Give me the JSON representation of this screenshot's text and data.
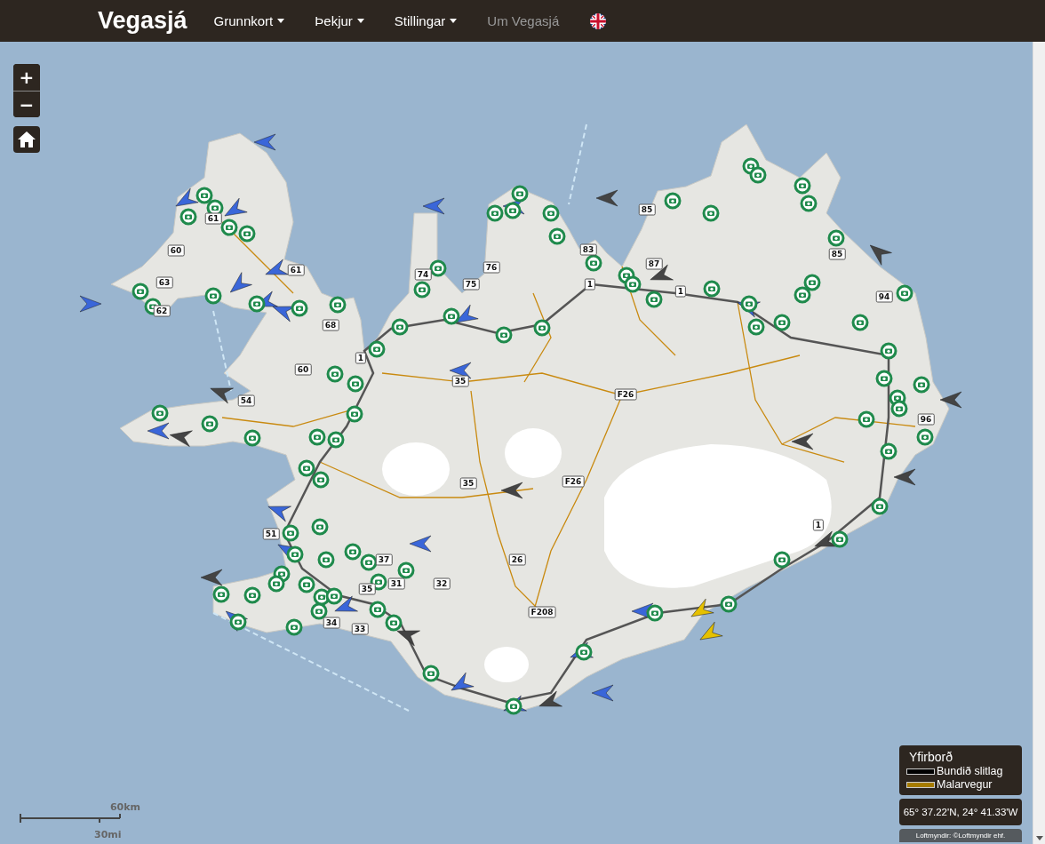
{
  "navbar": {
    "brand": "Vegasjá",
    "menus": [
      {
        "label": "Grunnkort",
        "dropdown": true
      },
      {
        "label": "Þekjur",
        "dropdown": true
      },
      {
        "label": "Stillingar",
        "dropdown": true
      },
      {
        "label": "Um Vegasjá",
        "dropdown": false
      }
    ]
  },
  "zoom_controls": {
    "zoom_in": "+",
    "zoom_out": "−"
  },
  "road_numbers": [
    "61",
    "60",
    "63",
    "62",
    "61",
    "68",
    "74",
    "75",
    "76",
    "83",
    "85",
    "87",
    "1",
    "1",
    "85",
    "94",
    "60",
    "1",
    "35",
    "F26",
    "54",
    "96",
    "35",
    "F26",
    "1",
    "26",
    "37",
    "31",
    "32",
    "35",
    "F208",
    "34",
    "33",
    "51"
  ],
  "legend": {
    "title": "Yfirborð",
    "items": [
      {
        "label": "Bundið slitlag",
        "color": "#000000"
      },
      {
        "label": "Malarvegur",
        "color": "#a67c00"
      }
    ]
  },
  "coordinates": "65° 37.22'N, 24° 41.33'W",
  "attribution": "Loftmyndir: ©Loftmyndir ehf.",
  "scale": {
    "metric": "60km",
    "imperial": "30mi"
  }
}
